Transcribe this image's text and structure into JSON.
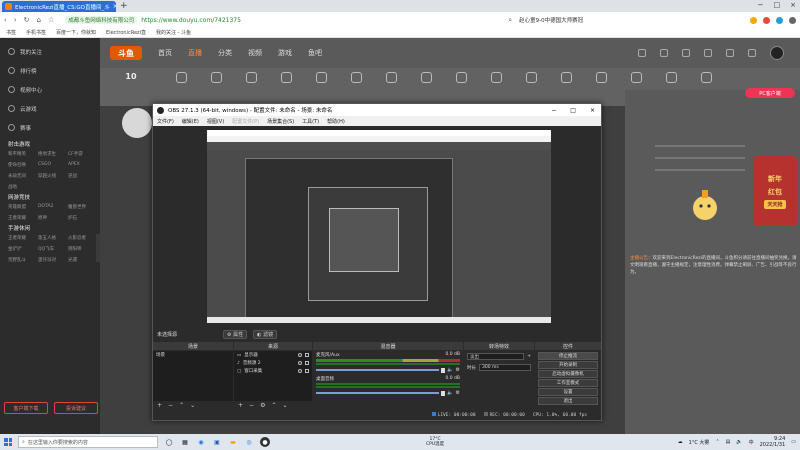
{
  "browser": {
    "tab_title": "ElectronicRezi直播_CS:GO直播间_斗",
    "tab_close": "×",
    "new_tab": "+",
    "window_min": "−",
    "window_max": "□",
    "window_close": "×",
    "cert_label": "成都斗鱼网络科技有限公司",
    "url": "https://www.douyu.com/7421375",
    "search_hint": "赵心童9-0中德国大师赛冠",
    "bookmarks": [
      "书签",
      "手机书签",
      "百度一下，你就知",
      "ElectronicRezi直",
      "我的关注 - 斗鱼"
    ]
  },
  "douyu": {
    "logo": "斗鱼",
    "nav": [
      {
        "label": "首页",
        "active": false
      },
      {
        "label": "直播",
        "active": true
      },
      {
        "label": "分类",
        "active": false
      },
      {
        "label": "视频",
        "active": false
      },
      {
        "label": "游戏",
        "active": false
      },
      {
        "label": "鱼吧",
        "active": false
      }
    ],
    "left_menu": [
      "我的关注",
      "排行榜",
      "视频中心",
      "云游戏",
      "赛事"
    ],
    "left_sections": [
      {
        "title": "射击游戏",
        "items": [
          "和平精英",
          "绝地求生",
          "CF手游",
          "使命召唤",
          "CSGO",
          "APEX",
          "永劫无间",
          "穿越火线",
          "逆战",
          "战地"
        ]
      },
      {
        "title": "网游竞技",
        "items": [
          "英雄联盟",
          "DOTA2",
          "魔兽世界",
          "王者荣耀",
          "原神",
          "炉石"
        ]
      },
      {
        "title": "手游休闲",
        "items": [
          "王者荣耀",
          "第五人格",
          "火影忍者",
          "金铲铲",
          "QQ飞车",
          "阴阳师",
          "荒野乱斗",
          "蛋仔派对",
          "光遇"
        ]
      }
    ],
    "left_buttons": [
      "客户端下载",
      "投诉建议"
    ],
    "category_count": "10",
    "pc_badge": "PC客户端",
    "newyear_title": "新年",
    "newyear_title2": "红包",
    "newyear_sub": "天天抢",
    "notice_label": "主播公告",
    "notice_text": "：欢迎来到ElectronicRezi的直播间，斗鱼积分请前往直播间抽奖兑换。请文明观看直播，遵守主播规定，注意理性消费。弹幕禁止刷屏、广告、引战等不良行为。"
  },
  "obs": {
    "title": "OBS 27.1.3 (64-bit, windows) - 配置文件: 未命名 - 场景: 未命名",
    "menu": [
      "文件(F)",
      "编辑(E)",
      "视图(V)",
      "配置文件(P)",
      "场景集合(S)",
      "工具(T)",
      "帮助(H)"
    ],
    "menu_disabled_index": 3,
    "source_status": "未选择源",
    "props_button": "属性",
    "filters_button": "滤镜",
    "docks": {
      "scenes": {
        "title": "场景",
        "items": [
          "场景"
        ]
      },
      "sources": {
        "title": "来源",
        "items": [
          "显示器",
          "音频源 2",
          "窗口采集"
        ]
      },
      "mixer": {
        "title": "混音器",
        "channels": [
          {
            "name": "麦克风/Aux",
            "db": "0.0 dB"
          },
          {
            "name": "桌面音频",
            "db": "0.0 dB"
          }
        ]
      },
      "transitions": {
        "title": "转场特效",
        "type": "淡出",
        "duration_label": "时长",
        "duration": "300 ms"
      },
      "controls": {
        "title": "控件",
        "buttons": [
          "停止推流",
          "开始录制",
          "启动虚拟摄像机",
          "工作室模式",
          "设置",
          "退出"
        ]
      }
    },
    "status": {
      "live": "LIVE: 00:00:00",
      "rec": "REC: 00:00:00",
      "cpu": "CPU: 1.0%, 60.00 fps"
    }
  },
  "taskbar": {
    "search_placeholder": "在这里输入你要搜索的内容",
    "weather_temp": "17°C",
    "weather_desc": "CPU温度",
    "tray_weather": "1°C 大雾",
    "time": "9:24",
    "date": "2022/1/31"
  },
  "colors": {
    "accent_orange": "#ff7a00",
    "obs_bg": "#2b2b2b",
    "taskbar_bg": "#dfe6ee",
    "browser_tab": "#2b6fd6"
  }
}
